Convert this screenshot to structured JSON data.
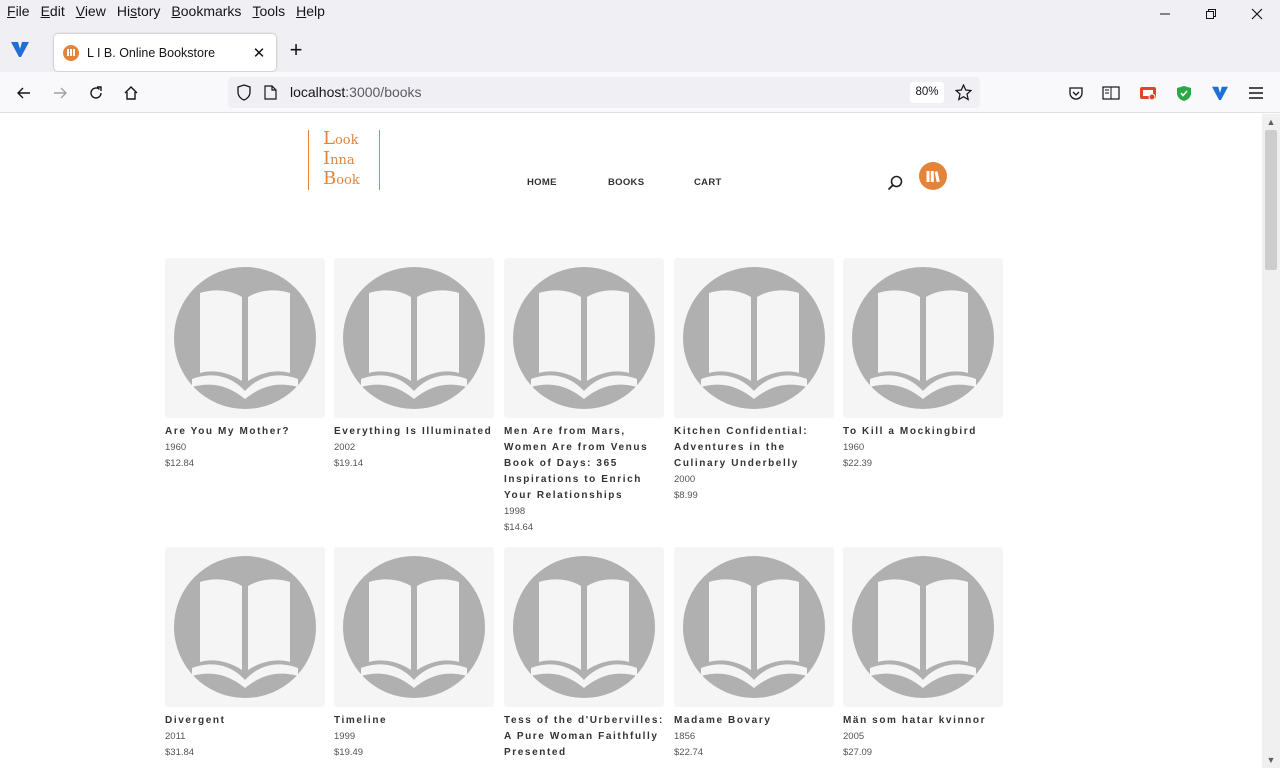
{
  "menubar": {
    "items": [
      {
        "pre": "",
        "u": "F",
        "post": "ile"
      },
      {
        "pre": "",
        "u": "E",
        "post": "dit"
      },
      {
        "pre": "",
        "u": "V",
        "post": "iew"
      },
      {
        "pre": "Hi",
        "u": "s",
        "post": "tory"
      },
      {
        "pre": "",
        "u": "B",
        "post": "ookmarks"
      },
      {
        "pre": "",
        "u": "T",
        "post": "ools"
      },
      {
        "pre": "",
        "u": "H",
        "post": "elp"
      }
    ]
  },
  "tab": {
    "title": "L I B. Online Bookstore",
    "close": "✕",
    "new_tab": "+"
  },
  "urlbar": {
    "host": "localhost",
    "path": ":3000/books",
    "zoom": "80%"
  },
  "site": {
    "logo": [
      {
        "big": "L",
        "small": "ook"
      },
      {
        "big": "I",
        "small": "nna"
      },
      {
        "big": "B",
        "small": "ook"
      }
    ],
    "nav": [
      "HOME",
      "BOOKS",
      "CART"
    ]
  },
  "books": [
    {
      "title": "Are You My Mother?",
      "year": "1960",
      "price": "$12.84"
    },
    {
      "title": "Everything Is Illuminated",
      "year": "2002",
      "price": "$19.14"
    },
    {
      "title": "Men Are from Mars, Women Are from Venus Book of Days: 365 Inspirations to Enrich Your Relationships",
      "year": "1998",
      "price": "$14.64"
    },
    {
      "title": "Kitchen Confidential: Adventures in the Culinary Underbelly",
      "year": "2000",
      "price": "$8.99"
    },
    {
      "title": "To Kill a Mockingbird",
      "year": "1960",
      "price": "$22.39"
    },
    {
      "title": "Divergent",
      "year": "2011",
      "price": "$31.84"
    },
    {
      "title": "Timeline",
      "year": "1999",
      "price": "$19.49"
    },
    {
      "title": "Tess of the d'Urbervilles: A Pure Woman Faithfully Presented",
      "year": "",
      "price": ""
    },
    {
      "title": "Madame Bovary",
      "year": "1856",
      "price": "$22.74"
    },
    {
      "title": "Män som hatar kvinnor",
      "year": "2005",
      "price": "$27.09"
    }
  ],
  "colors": {
    "accent": "#e4843a",
    "placeholder": "#b0b0b0"
  },
  "icons": {
    "book_placeholder": "open-book-icon",
    "search": "search-icon",
    "cart": "books-icon"
  }
}
